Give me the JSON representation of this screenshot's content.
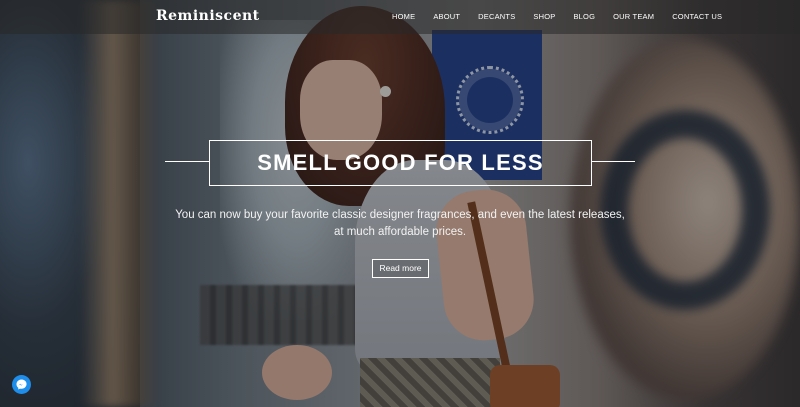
{
  "brand": {
    "logo_text": "Reminiscent"
  },
  "nav": {
    "items": [
      {
        "label": "HOME"
      },
      {
        "label": "ABOUT"
      },
      {
        "label": "DECANTS"
      },
      {
        "label": "SHOP"
      },
      {
        "label": "BLOG"
      },
      {
        "label": "OUR TEAM"
      },
      {
        "label": "CONTACT US"
      }
    ]
  },
  "hero": {
    "title": "SMELL GOOD FOR LESS",
    "subtitle": "You can now buy your favorite classic designer fragrances, and even the latest releases, at much affordable prices.",
    "cta_label": "Read more"
  },
  "chat_widget": {
    "icon": "messenger-icon",
    "color": "#1f8dea"
  }
}
